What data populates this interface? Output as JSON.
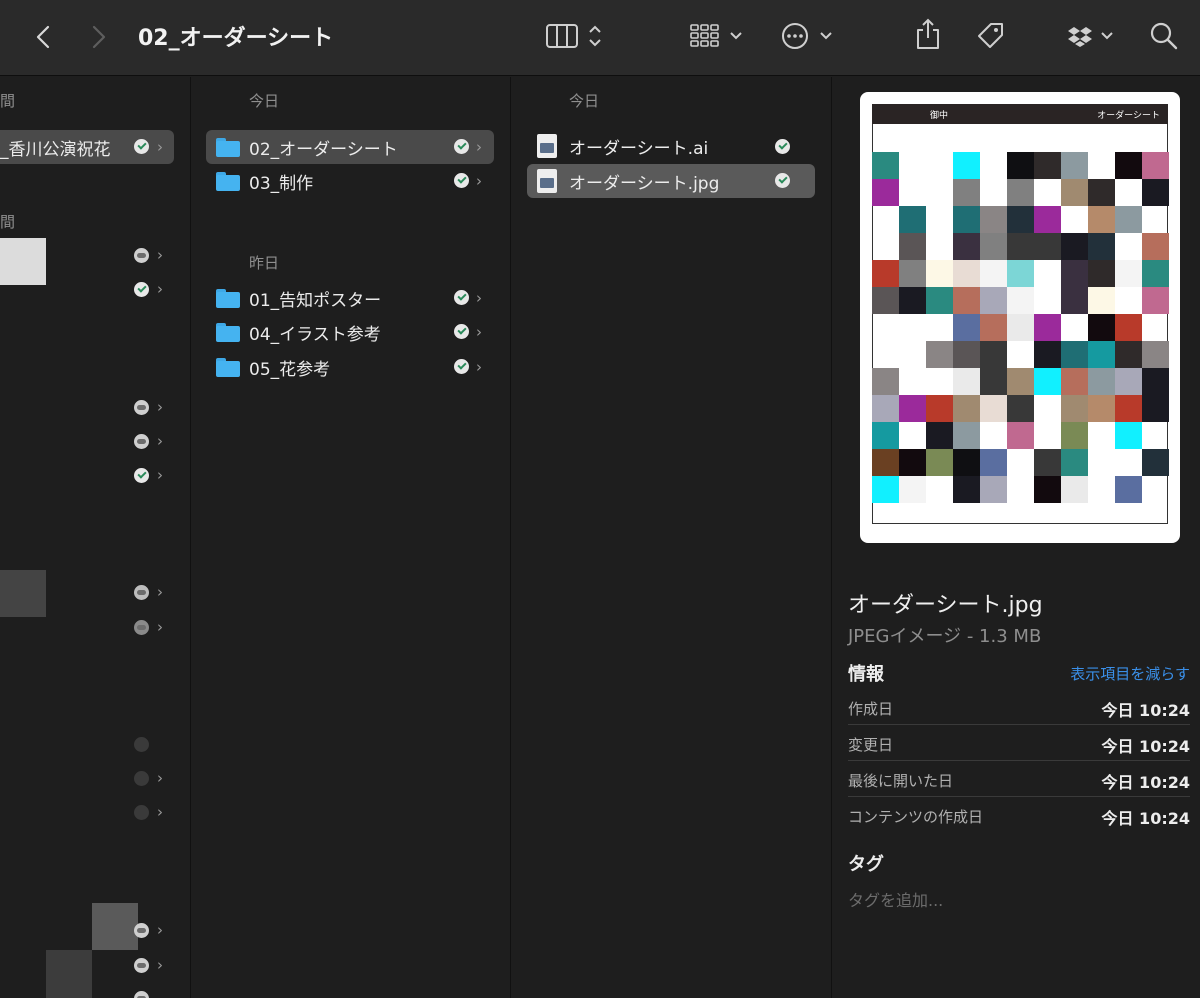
{
  "toolbar": {
    "title": "02_オーダーシート",
    "icons": [
      "back-icon",
      "forward-icon",
      "column-view-icon",
      "group-icon",
      "more-icon",
      "share-icon",
      "tag-icon",
      "dropbox-icon",
      "search-icon"
    ]
  },
  "col1": {
    "section_top": "間",
    "selected_label": "_香川公演祝花",
    "section_mid": "間"
  },
  "col2": {
    "today": "今日",
    "yesterday": "昨日",
    "items_today": [
      {
        "label": "02_オーダーシート",
        "selected": true
      },
      {
        "label": "03_制作",
        "selected": false
      }
    ],
    "items_yesterday": [
      {
        "label": "01_告知ポスター"
      },
      {
        "label": "04_イラスト参考"
      },
      {
        "label": "05_花参考"
      }
    ]
  },
  "col3": {
    "today": "今日",
    "files": [
      {
        "label": "オーダーシート.ai",
        "selected": false
      },
      {
        "label": "オーダーシート.jpg",
        "selected": true
      }
    ]
  },
  "preview": {
    "thumb_header_left": "御中",
    "thumb_header_right": "オーダーシート",
    "filename": "オーダーシート.jpg",
    "kind": "JPEGイメージ - 1.3 MB",
    "info_heading": "情報",
    "show_less": "表示項目を減らす",
    "info": [
      {
        "key": "作成日",
        "value": "今日 10:24"
      },
      {
        "key": "変更日",
        "value": "今日 10:24"
      },
      {
        "key": "最後に開いた日",
        "value": "今日 10:24"
      },
      {
        "key": "コンテンツの作成日",
        "value": "今日 10:24"
      }
    ],
    "tags_heading": "タグ",
    "tags_placeholder": "タグを追加..."
  },
  "colors": {
    "accent_link": "#3a8fe8",
    "folder": "#45b3f0",
    "selection": "#4a4a4a"
  }
}
